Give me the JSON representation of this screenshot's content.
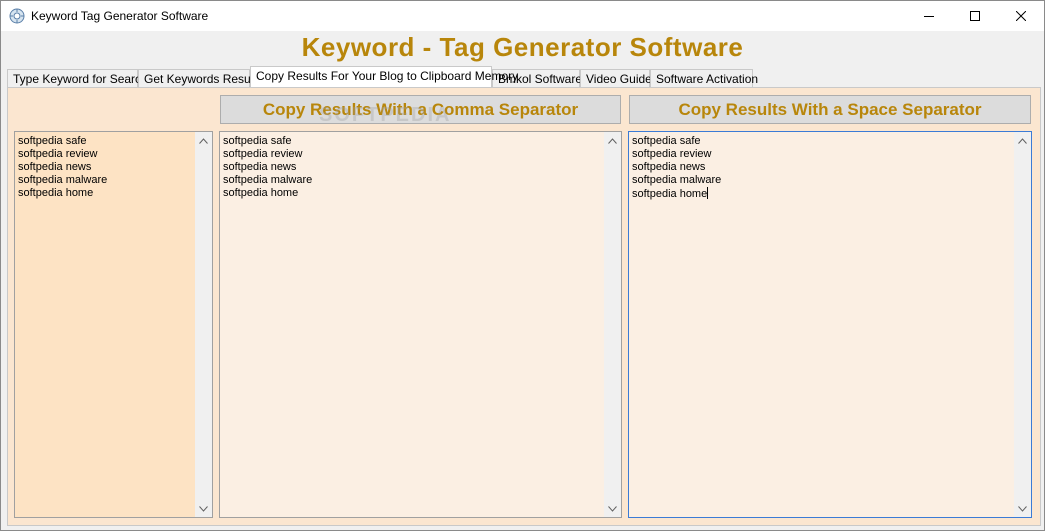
{
  "window": {
    "title": "Keyword Tag Generator Software"
  },
  "app": {
    "heading": "Keyword - Tag Generator Software",
    "accent_color": "#b8860b"
  },
  "tabs": [
    {
      "label": "Type Keyword for Search",
      "active": false
    },
    {
      "label": "Get Keywords Result",
      "active": false
    },
    {
      "label": "Copy Results For Your Blog to Clipboard Memory",
      "active": true
    },
    {
      "label": "Bmkol Softwares",
      "active": false
    },
    {
      "label": "Video Guide",
      "active": false
    },
    {
      "label": "Software Activation",
      "active": false
    }
  ],
  "buttons": {
    "comma_label": "Copy Results With a Comma Separator",
    "space_label": "Copy Results With a Space Separator"
  },
  "lists": {
    "source": [
      "softpedia safe",
      "softpedia review",
      "softpedia news",
      "softpedia malware",
      "softpedia home"
    ],
    "comma_result": [
      "softpedia safe",
      "softpedia review",
      "softpedia news",
      "softpedia malware",
      "softpedia home"
    ],
    "space_result": [
      "softpedia safe",
      "softpedia review",
      "softpedia news",
      "softpedia malware",
      "softpedia home"
    ]
  },
  "watermark": "SOFTPEDIA"
}
